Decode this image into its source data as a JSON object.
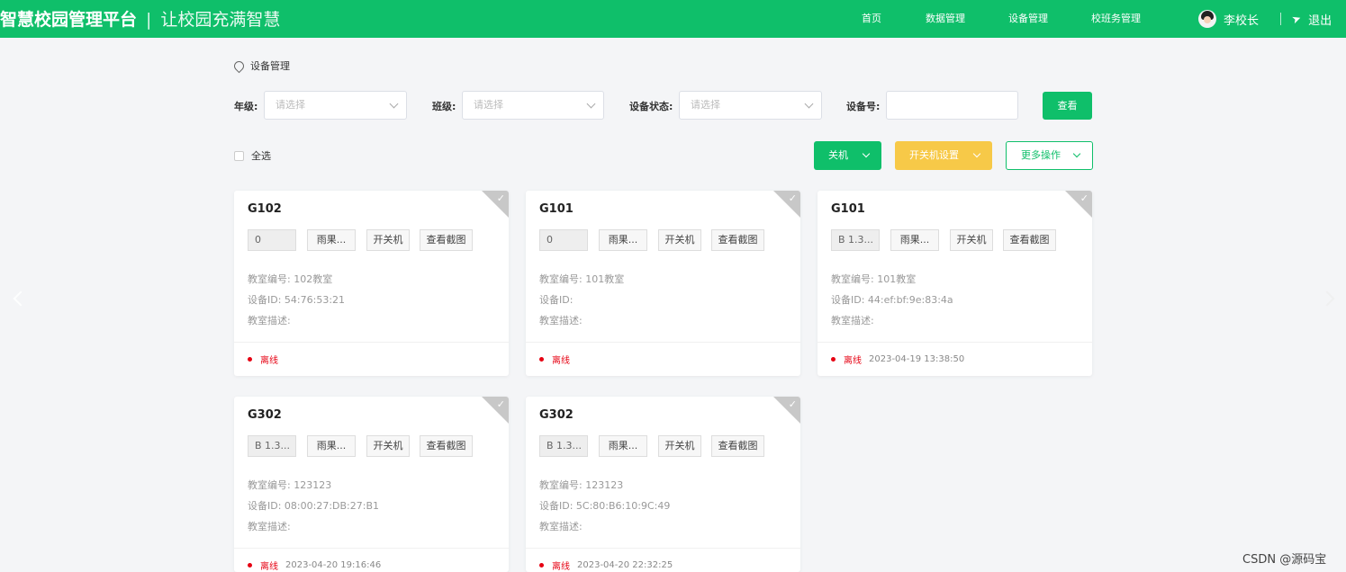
{
  "header": {
    "brand": "智慧校园管理平台",
    "separator": "|",
    "slogan": "让校园充满智慧",
    "nav": [
      "首页",
      "数据管理",
      "设备管理",
      "校班务管理"
    ],
    "user_name": "李校长",
    "logout": "退出"
  },
  "breadcrumb": "设备管理",
  "filters": {
    "grade_label": "年级:",
    "grade_placeholder": "请选择",
    "class_label": "班级:",
    "class_placeholder": "请选择",
    "status_label": "设备状态:",
    "status_placeholder": "请选择",
    "device_no_label": "设备号:",
    "device_no_value": "",
    "query_button": "查看"
  },
  "toolbar": {
    "select_all": "全选",
    "shutdown": "关机",
    "power_settings": "开关机设置",
    "more_actions": "更多操作"
  },
  "card_labels": {
    "classroom_no": "教室编号:",
    "device_id": "设备ID:",
    "classroom_desc": "教室描述:",
    "btn_power": "开关机",
    "btn_screenshot": "查看截图"
  },
  "devices": [
    {
      "title": "G102",
      "value": "0",
      "option": "雨果...",
      "classroom": "102教室",
      "device_id": "54:76:53:21",
      "desc": "",
      "status": "离线",
      "time": ""
    },
    {
      "title": "G101",
      "value": "0",
      "option": "雨果...",
      "classroom": "101教室",
      "device_id": "",
      "desc": "",
      "status": "离线",
      "time": ""
    },
    {
      "title": "G101",
      "value": "B 1.3...",
      "option": "雨果...",
      "classroom": "101教室",
      "device_id": "44:ef:bf:9e:83:4a",
      "desc": "",
      "status": "离线",
      "time": "2023-04-19 13:38:50"
    },
    {
      "title": "G302",
      "value": "B 1.3...",
      "option": "雨果...",
      "classroom": "123123",
      "device_id": "08:00:27:DB:27:B1",
      "desc": "",
      "status": "离线",
      "time": "2023-04-20 19:16:46"
    },
    {
      "title": "G302",
      "value": "B 1.3...",
      "option": "雨果...",
      "classroom": "123123",
      "device_id": "5C:80:B6:10:9C:49",
      "desc": "",
      "status": "离线",
      "time": "2023-04-20 22:32:25"
    }
  ],
  "watermark": "CSDN @源码宝",
  "colors": {
    "primary": "#0fbf6a",
    "warning": "#f7c948",
    "offline": "#e60012"
  }
}
